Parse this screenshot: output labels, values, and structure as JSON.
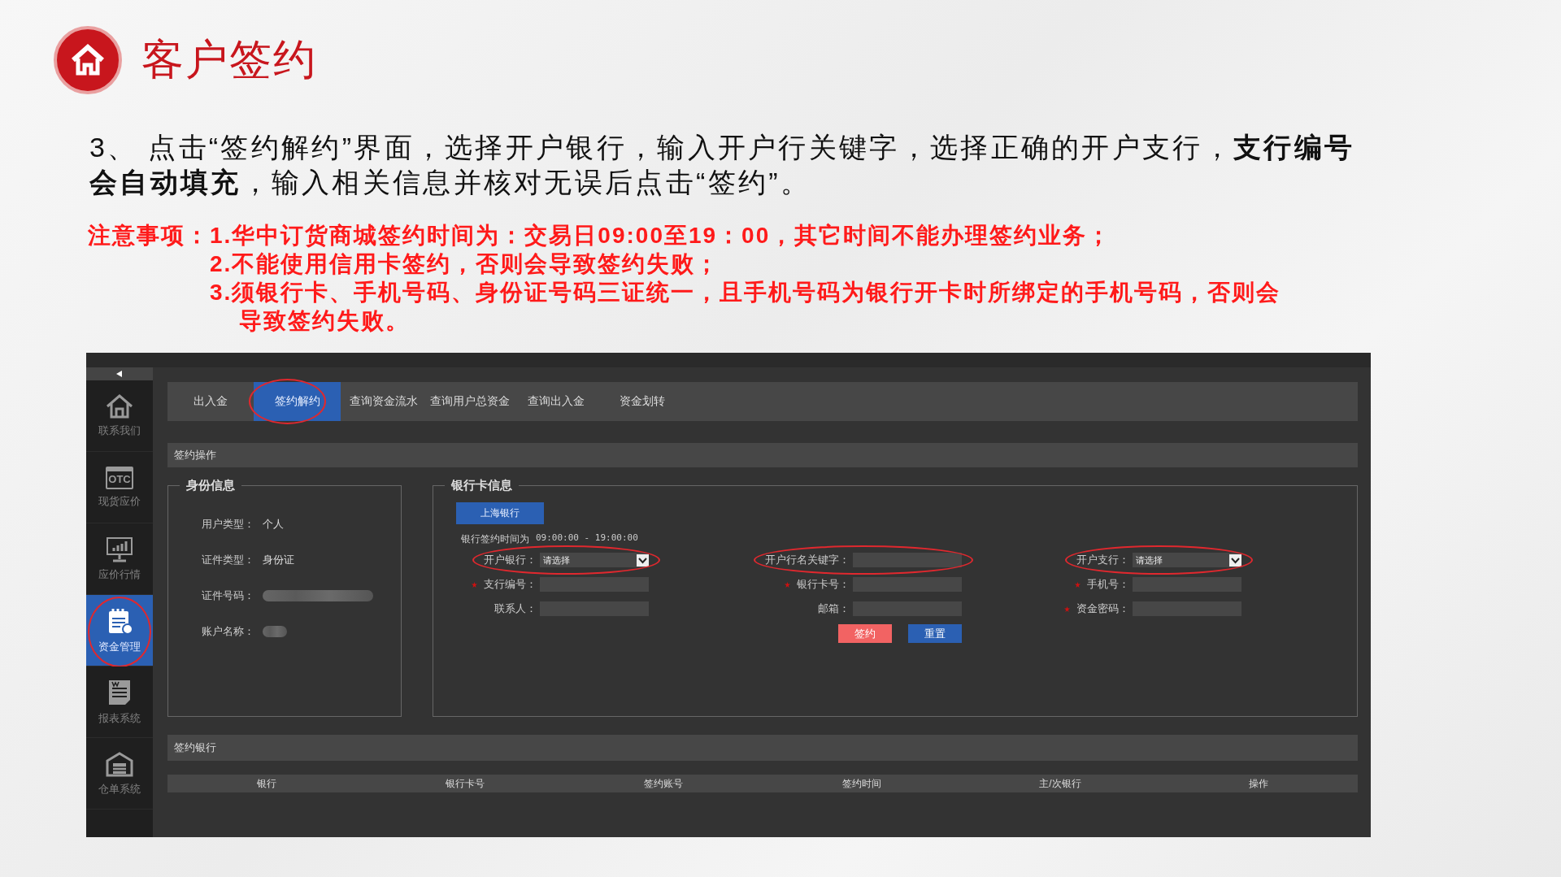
{
  "header": {
    "title": "客户签约"
  },
  "instruction": "3、 点击“签约解约”界面，选择开户银行，输入开户行关键字，选择正确的开户支行，**支行编号会自动填充**，输入相关信息并核对无误后点击“签约”。",
  "notes": {
    "label": "注意事项：",
    "items": [
      "1.华中订货商城签约时间为：交易日09:00至19：00，其它时间不能办理签约业务；",
      "2.不能使用信用卡签约，否则会导致签约失败；",
      "3.须银行卡、手机号码、身份证号码三证统一，且手机号码为银行开卡时所绑定的手机号码，否则会导致签约失败。"
    ]
  },
  "app": {
    "sidebar": [
      {
        "label": "联系我们",
        "kind": "home",
        "selected": false,
        "circled": false
      },
      {
        "label": "现货应价",
        "kind": "otc",
        "badge": "OTC",
        "selected": false,
        "circled": false
      },
      {
        "label": "应价行情",
        "kind": "chart",
        "selected": false,
        "circled": false
      },
      {
        "label": "资金管理",
        "kind": "notebook",
        "selected": true,
        "circled": true
      },
      {
        "label": "报表系统",
        "kind": "document",
        "selected": false,
        "circled": false
      },
      {
        "label": "仓单系统",
        "kind": "warehouse",
        "selected": false,
        "circled": false
      }
    ],
    "tabs": [
      {
        "label": "出入金",
        "selected": false,
        "circled": false
      },
      {
        "label": "签约解约",
        "selected": true,
        "circled": true
      },
      {
        "label": "查询资金流水",
        "selected": false,
        "circled": false
      },
      {
        "label": "查询用户总资金",
        "selected": false,
        "circled": false
      },
      {
        "label": "查询出入金",
        "selected": false,
        "circled": false
      },
      {
        "label": "资金划转",
        "selected": false,
        "circled": false
      }
    ],
    "section_title": "签约操作",
    "identity": {
      "title": "身份信息",
      "fields": [
        {
          "label": "用户类型：",
          "kind": "text",
          "value": "个人"
        },
        {
          "label": "证件类型：",
          "kind": "text",
          "value": "身份证"
        },
        {
          "label": "证件号码：",
          "kind": "masked"
        },
        {
          "label": "账户名称：",
          "kind": "masked"
        }
      ]
    },
    "bank": {
      "title": "银行卡信息",
      "bank_tab": "上海银行",
      "time_label": "银行签约时间为",
      "time_range": "09:00:00 - 19:00:00",
      "fields": [
        {
          "label": "开户银行：",
          "kind": "select",
          "value": "请选择",
          "required": false,
          "circled": true
        },
        {
          "label": "开户行名关键字：",
          "kind": "input",
          "required": false,
          "circled": true
        },
        {
          "label": "开户支行：",
          "kind": "select",
          "value": "请选择",
          "required": false,
          "circled": true
        },
        {
          "label": "支行编号：",
          "kind": "input",
          "required": true,
          "circled": false
        },
        {
          "label": "银行卡号：",
          "kind": "input",
          "required": true,
          "circled": false
        },
        {
          "label": "手机号：",
          "kind": "input",
          "required": true,
          "circled": false
        },
        {
          "label": "联系人：",
          "kind": "input",
          "required": false,
          "circled": false
        },
        {
          "label": "邮箱：",
          "kind": "input",
          "required": false,
          "circled": false
        },
        {
          "label": "资金密码：",
          "kind": "input",
          "required": true,
          "circled": false
        }
      ],
      "buttons": [
        {
          "label": "签约",
          "kind": "danger"
        },
        {
          "label": "重置",
          "kind": "primary"
        }
      ]
    },
    "signed_banks": {
      "title": "签约银行",
      "columns": [
        "银行",
        "银行卡号",
        "签约账号",
        "签约时间",
        "主/次银行",
        "操作"
      ]
    }
  }
}
